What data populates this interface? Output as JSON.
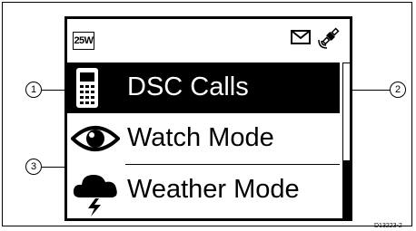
{
  "status_bar": {
    "power_label": "25W",
    "icons": [
      "envelope-icon",
      "satellite-icon"
    ]
  },
  "menu": {
    "items": [
      {
        "label": "DSC Calls",
        "icon": "handset-icon",
        "selected": true
      },
      {
        "label": "Watch Mode",
        "icon": "eye-icon",
        "selected": false
      },
      {
        "label": "Weather Mode",
        "icon": "storm-cloud-icon",
        "selected": false
      }
    ]
  },
  "callouts": [
    "1",
    "2",
    "3"
  ],
  "figure_code": "D13223-2",
  "colors": {
    "foreground": "#000000",
    "background": "#ffffff"
  }
}
